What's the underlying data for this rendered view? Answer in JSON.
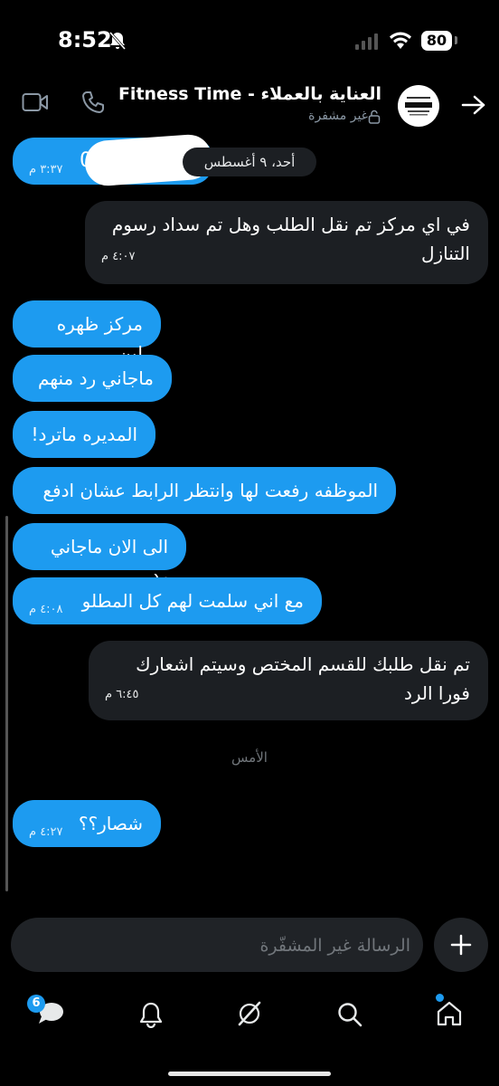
{
  "status_bar": {
    "time": "8:52",
    "battery": "80"
  },
  "header": {
    "title": "العناية بالعملاء - Fitness Time",
    "subtitle": "غير مشفرة"
  },
  "conversation": {
    "date_chip": "أحد، ٩ أغسطس",
    "first_bubble": {
      "text": "0",
      "time": "٣:٣٧ م"
    },
    "messages": [
      {
        "text": "في اي مركز تم نقل الطلب وهل تم سداد رسوم التنازل",
        "time": "٤:٠٧ م",
        "sender": "other"
      },
      {
        "text": "مركز ظهره لبن",
        "sender": "me"
      },
      {
        "text": "ماجاني رد منهم",
        "sender": "me"
      },
      {
        "text": "المديره ماترد!",
        "sender": "me"
      },
      {
        "text": "الموظفه رفعت لها وانتظر الرابط عشان ادفع",
        "sender": "me"
      },
      {
        "text": "الى الان ماجاني رد",
        "sender": "me"
      },
      {
        "text": "مع اني سلمت لهم كل المطلو",
        "time": "٤:٠٨ م",
        "sender": "me"
      },
      {
        "text": "تم نقل طلبك للقسم المختص وسيتم اشعارك فورا الرد",
        "time": "٦:٤٥ م",
        "sender": "other"
      }
    ],
    "divider": "الأمس",
    "last_message": {
      "text": "شصار؟؟",
      "time": "٤:٢٧ م",
      "sender": "me"
    }
  },
  "composer": {
    "placeholder": "الرسالة غير المشفّرة"
  },
  "tabbar": {
    "messages_badge": "6"
  },
  "colors": {
    "accent": "#1d9bf0",
    "bubble_other": "#1c1f23",
    "background": "#000000"
  }
}
